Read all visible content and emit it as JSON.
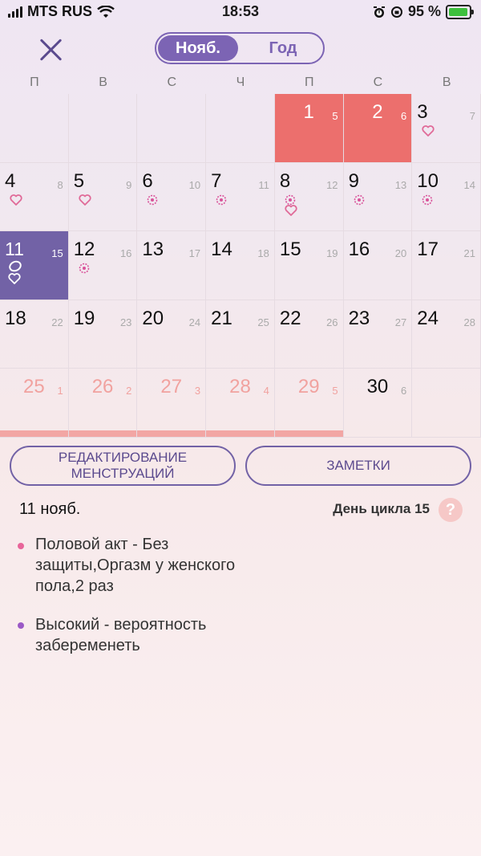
{
  "status_bar": {
    "carrier": "MTS RUS",
    "time": "18:53",
    "battery": "95 %"
  },
  "header": {
    "tab_month": "Нояб.",
    "tab_year": "Год"
  },
  "weekdays": [
    "П",
    "В",
    "С",
    "Ч",
    "П",
    "С",
    "В"
  ],
  "calendar": {
    "month": "Ноябрь",
    "days": [
      {
        "day": "1",
        "cycle": "5",
        "state": "period"
      },
      {
        "day": "2",
        "cycle": "6",
        "state": "period"
      },
      {
        "day": "3",
        "cycle": "7",
        "icons": [
          "heart"
        ]
      },
      {
        "day": "4",
        "cycle": "8",
        "icons": [
          "heart"
        ]
      },
      {
        "day": "5",
        "cycle": "9",
        "icons": [
          "heart"
        ]
      },
      {
        "day": "6",
        "cycle": "10",
        "icons": [
          "flower"
        ]
      },
      {
        "day": "7",
        "cycle": "11",
        "icons": [
          "flower"
        ]
      },
      {
        "day": "8",
        "cycle": "12",
        "icons": [
          "flower",
          "heart"
        ]
      },
      {
        "day": "9",
        "cycle": "13",
        "icons": [
          "flower"
        ]
      },
      {
        "day": "10",
        "cycle": "14",
        "icons": [
          "flower"
        ]
      },
      {
        "day": "11",
        "cycle": "15",
        "state": "today",
        "icons": [
          "oval",
          "heart"
        ]
      },
      {
        "day": "12",
        "cycle": "16",
        "icons": [
          "flower"
        ]
      },
      {
        "day": "13",
        "cycle": "17"
      },
      {
        "day": "14",
        "cycle": "18"
      },
      {
        "day": "15",
        "cycle": "19"
      },
      {
        "day": "16",
        "cycle": "20"
      },
      {
        "day": "17",
        "cycle": "21"
      },
      {
        "day": "18",
        "cycle": "22"
      },
      {
        "day": "19",
        "cycle": "23"
      },
      {
        "day": "20",
        "cycle": "24"
      },
      {
        "day": "21",
        "cycle": "25"
      },
      {
        "day": "22",
        "cycle": "26"
      },
      {
        "day": "23",
        "cycle": "27"
      },
      {
        "day": "24",
        "cycle": "28"
      },
      {
        "day": "25",
        "cycle": "1",
        "state": "predicted"
      },
      {
        "day": "26",
        "cycle": "2",
        "state": "predicted"
      },
      {
        "day": "27",
        "cycle": "3",
        "state": "predicted"
      },
      {
        "day": "28",
        "cycle": "4",
        "state": "predicted"
      },
      {
        "day": "29",
        "cycle": "5",
        "state": "predicted"
      },
      {
        "day": "30",
        "cycle": "6"
      }
    ]
  },
  "buttons": {
    "edit_label": "РЕДАКТИРОВАНИЕ\nМЕНСТРУАЦИЙ",
    "notes_label": "ЗАМЕТКИ"
  },
  "details": {
    "date": "11 нояб.",
    "cycle_day": "День цикла 15",
    "help": "?",
    "notes": [
      {
        "text": "Половой акт - Без защиты,Оргазм у женского пола,2 раз",
        "color": "#e8659a"
      },
      {
        "text": "Высокий - вероятность забеременеть",
        "color": "#9b59c6"
      }
    ]
  },
  "colors": {
    "accent": "#7262a6",
    "period": "#ec6f6d",
    "predicted": "#f2a6a4"
  }
}
